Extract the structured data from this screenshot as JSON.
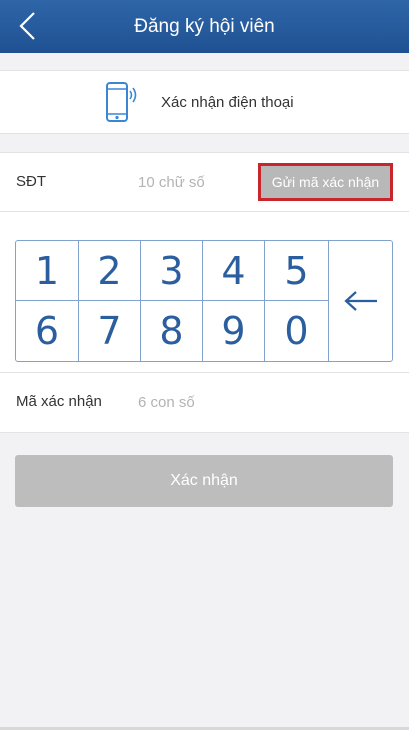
{
  "header": {
    "title": "Đăng ký hội viên",
    "back_icon": "chevron-left-icon"
  },
  "phone_verify": {
    "icon": "smartphone-icon",
    "label": "Xác nhận điện thoại"
  },
  "phone_field": {
    "label": "SĐT",
    "placeholder": "10 chữ số",
    "value": "",
    "send_code_label": "Gửi mã xác nhận"
  },
  "keypad": {
    "rows": [
      [
        "1",
        "2",
        "3",
        "4",
        "5"
      ],
      [
        "6",
        "7",
        "8",
        "9",
        "0"
      ]
    ],
    "backspace_icon": "arrow-left-icon"
  },
  "code_field": {
    "label": "Mã xác nhận",
    "placeholder": "6 con số",
    "value": ""
  },
  "confirm": {
    "label": "Xác nhận"
  },
  "colors": {
    "header_bg": "#2a5fa3",
    "keypad_digit": "#2b5e9e",
    "send_button_highlight": "#c9252c",
    "disabled_button": "#bdbdbd"
  }
}
